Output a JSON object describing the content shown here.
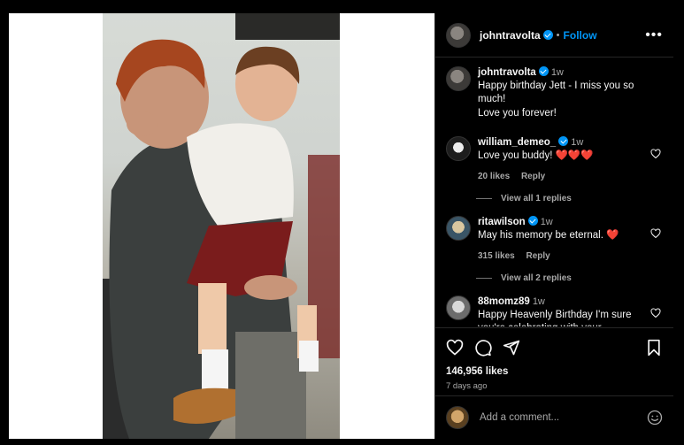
{
  "post": {
    "author": "johntravolta",
    "follow_label": "Follow",
    "more_label": "•••",
    "separator": "•"
  },
  "comments": [
    {
      "user": "johntravolta",
      "verified": true,
      "time": "1w",
      "lines": [
        "Happy birthday Jett - I miss you so much!",
        "Love you forever!"
      ]
    },
    {
      "user": "william_demeo_",
      "verified": true,
      "time": "1w",
      "text": "Love you buddy! ❤️❤️❤️",
      "likes": "20 likes",
      "reply": "Reply",
      "view_replies": "View all 1 replies"
    },
    {
      "user": "ritawilson",
      "verified": true,
      "time": "1w",
      "text": "May his memory be eternal. ❤️",
      "likes": "315 likes",
      "reply": "Reply",
      "view_replies": "View all 2 replies"
    },
    {
      "user": "88momz89",
      "verified": false,
      "time": "1w",
      "text": "Happy Heavenly Birthday I'm sure you're celebrating with your"
    }
  ],
  "stats": {
    "likes": "146,956 likes",
    "posted": "7 days ago"
  },
  "composer": {
    "placeholder": "Add a comment..."
  },
  "colors": {
    "accent": "#0095f6",
    "background": "#000000",
    "muted": "#a8a8a8"
  }
}
